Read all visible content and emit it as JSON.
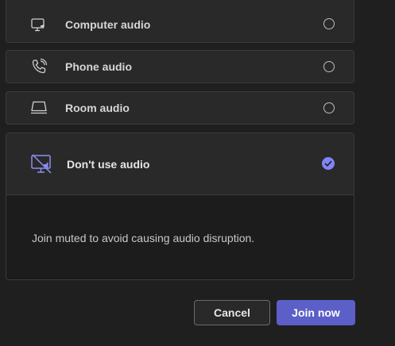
{
  "options": [
    {
      "icon": "computer-audio-icon",
      "label": "Computer audio",
      "selected": false
    },
    {
      "icon": "phone-audio-icon",
      "label": "Phone audio",
      "selected": false
    },
    {
      "icon": "room-audio-icon",
      "label": "Room audio",
      "selected": false
    }
  ],
  "selected_option": {
    "icon": "no-audio-icon",
    "label": "Don't use audio",
    "selected": true,
    "description": "Join muted to avoid causing audio disruption."
  },
  "buttons": {
    "cancel_label": "Cancel",
    "join_label": "Join now"
  },
  "colors": {
    "accent": "#5b5fc7",
    "accent_light": "#7f85f5",
    "background": "#1f1f1f",
    "card": "#292929"
  }
}
